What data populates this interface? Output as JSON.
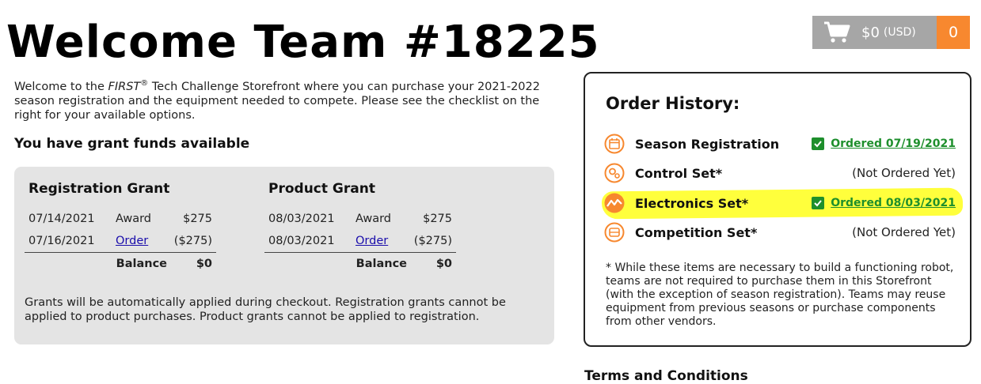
{
  "page_title": "Welcome Team #18225",
  "cart": {
    "amount": "$0",
    "currency": "(USD)",
    "count": "0",
    "icon": "shopping-cart-icon"
  },
  "intro": {
    "part1": "Welcome to the ",
    "first": "FIRST",
    "reg": "®",
    "part2": " Tech Challenge Storefront where you can purchase your 2021-2022 season registration and the equipment needed to compete. Please see the checklist on the right for your available options."
  },
  "grants": {
    "heading": "You have grant funds available",
    "items": [
      {
        "title": "Registration Grant",
        "rows": [
          {
            "date": "07/14/2021",
            "type": "Award",
            "amount": "$275"
          },
          {
            "date": "07/16/2021",
            "type": "Order",
            "amount": "($275)"
          }
        ],
        "balance_label": "Balance",
        "balance": "$0"
      },
      {
        "title": "Product Grant",
        "rows": [
          {
            "date": "08/03/2021",
            "type": "Award",
            "amount": "$275"
          },
          {
            "date": "08/03/2021",
            "type": "Order",
            "amount": "($275)"
          }
        ],
        "balance_label": "Balance",
        "balance": "$0"
      }
    ],
    "note": "Grants will be automatically applied during checkout. Registration grants cannot be applied to product purchases. Product grants cannot be applied to registration."
  },
  "order_history": {
    "title": "Order History:",
    "items": [
      {
        "name": "Season Registration",
        "status": "Ordered 07/19/2021",
        "ordered": true,
        "icon": "calendar-icon"
      },
      {
        "name": "Control Set*",
        "status": "(Not Ordered Yet)",
        "ordered": false,
        "icon": "gears-icon"
      },
      {
        "name": "Electronics Set*",
        "status": "Ordered 08/03/2021",
        "ordered": true,
        "icon": "signal-icon"
      },
      {
        "name": "Competition Set*",
        "status": "(Not Ordered Yet)",
        "ordered": false,
        "icon": "field-icon"
      }
    ],
    "note": "* While these items are necessary to build a functioning robot, teams are not required to purchase them in this Storefront (with the exception of season registration). Teams may reuse equipment from previous seasons or purchase components from other vendors."
  },
  "terms": "Terms and Conditions",
  "colors": {
    "accent": "#f7882f",
    "cart_bg": "#a6a6a6",
    "ordered_green": "#1e8f2c",
    "highlight": "#ffff3c",
    "grant_bg": "#e4e4e4"
  }
}
